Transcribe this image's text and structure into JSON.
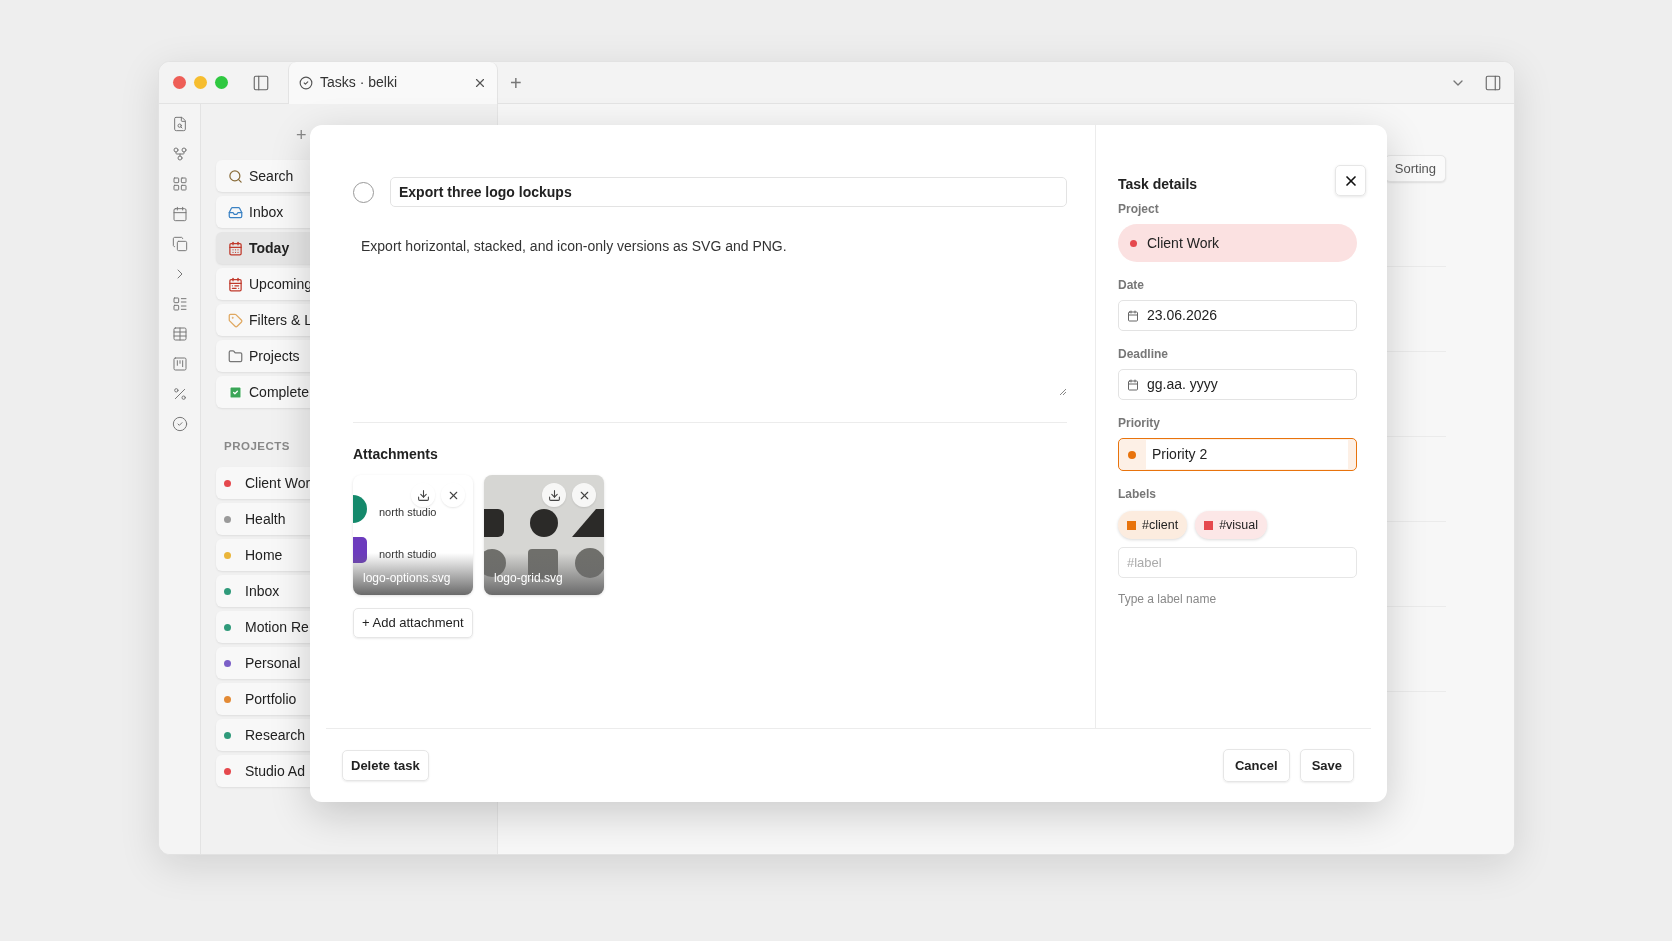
{
  "window": {
    "tab_title": "Tasks · belki",
    "new_tab": "+"
  },
  "sidebar": {
    "add": "+",
    "nav": [
      {
        "kind": "search",
        "label": "Search",
        "selected": false
      },
      {
        "kind": "inbox",
        "label": "Inbox",
        "selected": false
      },
      {
        "kind": "today",
        "label": "Today",
        "selected": true
      },
      {
        "kind": "upcoming",
        "label": "Upcoming",
        "selected": false
      },
      {
        "kind": "filters",
        "label": "Filters & L",
        "selected": false
      },
      {
        "kind": "projects",
        "label": "Projects",
        "selected": false
      },
      {
        "kind": "completed",
        "label": "Complete",
        "selected": false
      }
    ],
    "projects_heading": "PROJECTS",
    "projects": [
      {
        "label": "Client Wor",
        "color": "#e5484d"
      },
      {
        "label": "Health",
        "color": "#9a9a9a"
      },
      {
        "label": "Home",
        "color": "#eab53a"
      },
      {
        "label": "Inbox",
        "color": "#2f9a7a"
      },
      {
        "label": "Motion Re",
        "color": "#2f9a7a"
      },
      {
        "label": "Personal",
        "color": "#7b5fc7"
      },
      {
        "label": "Portfolio",
        "color": "#e38a34"
      },
      {
        "label": "Research",
        "color": "#2f9a7a"
      },
      {
        "label": "Studio Ad",
        "color": "#e5484d"
      }
    ]
  },
  "toolbar": {
    "sorting": "Sorting"
  },
  "task": {
    "completed": false,
    "title": "Export three logo lockups",
    "description": "Export horizontal, stacked, and icon-only versions as SVG and PNG."
  },
  "attachments": {
    "heading": "Attachments",
    "files": [
      {
        "kind": "logo-options",
        "name": "logo-options.svg",
        "preview_texts": [
          "north studio",
          "north studio"
        ]
      },
      {
        "kind": "logo-grid",
        "name": "logo-grid.svg"
      }
    ],
    "add_button": "+ Add attachment"
  },
  "details": {
    "title": "Task details",
    "project": {
      "label": "Project",
      "value": "Client Work",
      "color": "#e5484d"
    },
    "date": {
      "label": "Date",
      "value": "23.06.2026"
    },
    "deadline": {
      "label": "Deadline",
      "value": "gg.aa. yyyy"
    },
    "priority": {
      "label": "Priority",
      "value": "Priority 2",
      "color": "#e8730c"
    },
    "labels": {
      "label": "Labels",
      "items": [
        {
          "name": "#client",
          "color": "#e8730c"
        },
        {
          "name": "#visual",
          "color": "#e5484d"
        }
      ],
      "placeholder": "#label",
      "hint": "Type a label name"
    }
  },
  "footer": {
    "delete": "Delete task",
    "cancel": "Cancel",
    "save": "Save"
  }
}
